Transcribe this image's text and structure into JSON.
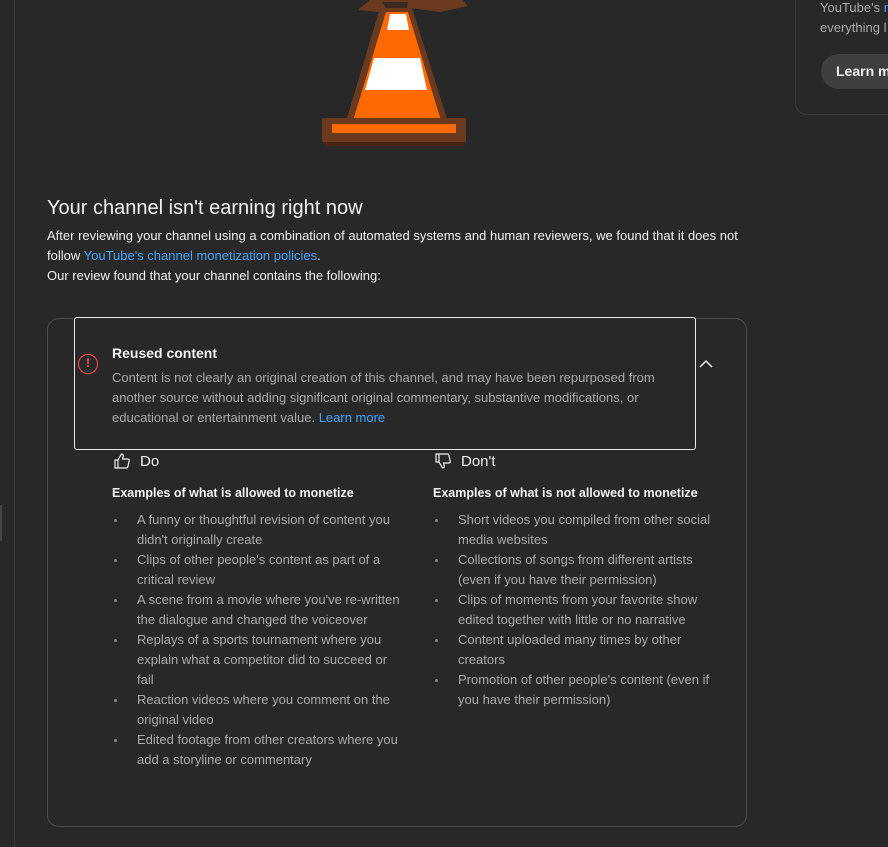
{
  "side_panel": {
    "line1_prefix": "YouTube's ",
    "line1_link": "m",
    "line2": "everything l",
    "learn_button": "Learn m"
  },
  "status": {
    "heading": "Your channel isn't earning right now",
    "para1_text": "After reviewing your channel using a combination of automated systems and human reviewers, we found that it does not follow ",
    "para1_link": "YouTube's channel monetization policies",
    "para1_end": ".",
    "para2": "Our review found that your channel contains the following:"
  },
  "finding": {
    "icon": "alert-circle-icon",
    "title": "Reused content",
    "description": "Content is not clearly an original creation of this channel, and may have been repurposed from another source without adding significant original commentary, substantive modifications, or educational or entertainment value. ",
    "learn_more": "Learn more"
  },
  "do_column": {
    "icon": "thumbs-up-icon",
    "heading": "Do",
    "subheading": "Examples of what is allowed to monetize",
    "items": [
      "A funny or thoughtful revision of content you didn't originally create",
      "Clips of other people's content as part of a critical review",
      "A scene from a movie where you've re-written the dialogue and changed the voiceover",
      "Replays of a sports tournament where you explain what a competitor did to succeed or fail",
      "Reaction videos where you comment on the original video",
      "Edited footage from other creators where you add a storyline or commentary"
    ]
  },
  "dont_column": {
    "icon": "thumbs-down-icon",
    "heading": "Don't",
    "subheading": "Examples of what is not allowed to monetize",
    "items": [
      "Short videos you compiled from other social media websites",
      "Collections of songs from different artists (even if you have their permission)",
      "Clips of moments from your favorite show edited together with little or no narrative",
      "Content uploaded many times by other creators",
      "Promotion of other people's content (even if you have their permission)"
    ]
  },
  "colors": {
    "background": "#282828",
    "link": "#3ea6ff",
    "alert": "#ff4e45",
    "secondary_text": "#aaaaaa"
  }
}
